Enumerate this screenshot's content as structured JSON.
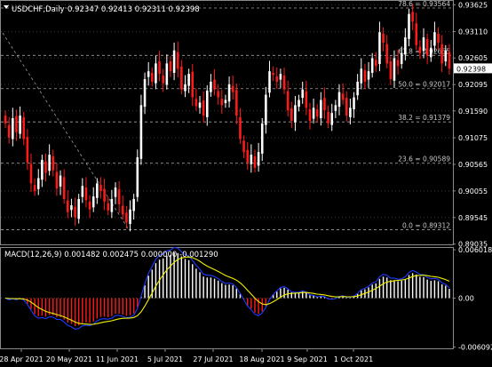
{
  "header": {
    "symbol_label": "USDCHF,Daily",
    "ohlc_label": "0.92347 0.92413 0.92311 0.92398"
  },
  "price_tag": "0.92398",
  "colors": {
    "background": "#000000",
    "bull": "#ffffff",
    "bear": "#ff1a1a",
    "grid": "#3a3a3a",
    "fib_line": "#a0a0a0",
    "macd_signal": "#f0f000",
    "macd_blue": "#1e3cff"
  },
  "chart_data": [
    {
      "type": "candlestick",
      "title": "USDCHF,Daily",
      "ylim": [
        0.8903,
        0.937
      ],
      "y_ticks": [
        "0.93625",
        "0.93110",
        "0.92605",
        "0.92095",
        "0.91590",
        "0.91075",
        "0.90565",
        "0.90055",
        "0.89545",
        "0.89035"
      ],
      "x_ticks": [
        "28 Apr 2021",
        "20 May 2021",
        "11 Jun 2021",
        "5 Jul 2021",
        "27 Jul 2021",
        "18 Aug 2021",
        "9 Sep 2021",
        "1 Oct 2021"
      ],
      "fibonacci": [
        {
          "label": "78.6 = 0.93564",
          "value": 0.93564
        },
        {
          "label": "61.8 = 0.92655",
          "value": 0.92655
        },
        {
          "label": "50.0 = 0.92017",
          "value": 0.92017
        },
        {
          "label": "38.2 = 0.91379",
          "value": 0.91379
        },
        {
          "label": "23.6 = 0.90589",
          "value": 0.90589
        },
        {
          "label": "0.0 = 0.89312",
          "value": 0.89312
        }
      ],
      "current_price": 0.92398,
      "closes": [
        0.9135,
        0.9108,
        0.9145,
        0.9118,
        0.915,
        0.9105,
        0.906,
        0.902,
        0.9005,
        0.903,
        0.9065,
        0.904,
        0.9075,
        0.9045,
        0.901,
        0.9035,
        0.899,
        0.8965,
        0.8978,
        0.8955,
        0.899,
        0.9015,
        0.8988,
        0.897,
        0.8995,
        0.902,
        0.9005,
        0.8985,
        0.8968,
        0.899,
        0.9012,
        0.898,
        0.896,
        0.8945,
        0.897,
        0.899,
        0.907,
        0.917,
        0.922,
        0.9235,
        0.9215,
        0.925,
        0.923,
        0.9212,
        0.925,
        0.9235,
        0.9275,
        0.924,
        0.92,
        0.921,
        0.923,
        0.9185,
        0.9168,
        0.9175,
        0.915,
        0.9198,
        0.9215,
        0.92,
        0.9185,
        0.917,
        0.918,
        0.921,
        0.9195,
        0.915,
        0.9105,
        0.908,
        0.906,
        0.9075,
        0.905,
        0.908,
        0.9135,
        0.919,
        0.9235,
        0.9228,
        0.9215,
        0.923,
        0.92,
        0.916,
        0.914,
        0.917,
        0.918,
        0.92,
        0.9165,
        0.914,
        0.9165,
        0.9148,
        0.918,
        0.916,
        0.9135,
        0.9155,
        0.917,
        0.9195,
        0.918,
        0.915,
        0.9165,
        0.9185,
        0.9215,
        0.924,
        0.9215,
        0.9235,
        0.926,
        0.9245,
        0.931,
        0.929,
        0.925,
        0.922,
        0.926,
        0.9245,
        0.927,
        0.93,
        0.9345,
        0.933,
        0.9285,
        0.927,
        0.93,
        0.9265,
        0.928,
        0.931,
        0.929,
        0.925,
        0.9275,
        0.924
      ]
    },
    {
      "type": "histogram",
      "title": "MACD(12,26,9) 0.001482 0.002475 0.000000 -0.001290",
      "series_names": [
        "MACD",
        "Signal"
      ],
      "ylim": [
        -0.00625,
        0.00625
      ],
      "y_ticks": [
        "0.006018",
        "0.00",
        "-0.006092"
      ]
    }
  ]
}
